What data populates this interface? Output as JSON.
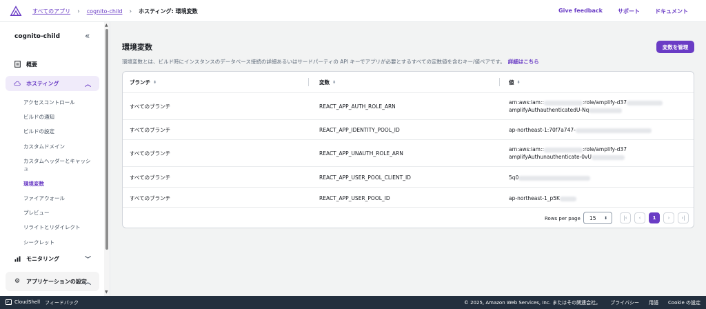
{
  "breadcrumb": {
    "items": [
      "すべてのアプリ",
      "cognito-child"
    ],
    "current": "ホスティング: 環境変数"
  },
  "top_links": [
    "Give feedback",
    "サポート",
    "ドキュメント"
  ],
  "sidebar": {
    "title": "cognito-child",
    "overview": "概要",
    "hosting": "ホスティング",
    "hosting_items": [
      "アクセスコントロール",
      "ビルドの通知",
      "ビルドの設定",
      "カスタムドメイン",
      "カスタムヘッダーとキャッシュ",
      "環境変数",
      "ファイアウォール",
      "プレビュー",
      "リライトとリダイレクト",
      "シークレット"
    ],
    "monitoring": "モニタリング",
    "app_settings": "アプリケーションの設定"
  },
  "main": {
    "title": "環境変数",
    "manage_button": "変数を管理",
    "description": "環境変数とは、ビルド時にインスタンスのデータベース接続の詳細あるいはサードパーティの API キーでアプリが必要とするすべての定数値を含むキー/値ペアです。",
    "description_link": "詳細はこちら"
  },
  "table": {
    "headers": [
      "ブランチ",
      "変数",
      "値"
    ],
    "rows": [
      {
        "branch": "すべてのブランチ",
        "variable": "REACT_APP_AUTH_ROLE_ARN",
        "value_line1": "arn:aws:iam::",
        "value_line1b": ":role/amplify-d37",
        "value_line2": "amplifyAuthauthenticatedU-Nq"
      },
      {
        "branch": "すべてのブランチ",
        "variable": "REACT_APP_IDENTITY_POOL_ID",
        "value_line1": "ap-northeast-1:70f7a747-"
      },
      {
        "branch": "すべてのブランチ",
        "variable": "REACT_APP_UNAUTH_ROLE_ARN",
        "value_line1": "arn:aws:iam::",
        "value_line1b": ":role/amplify-d37",
        "value_line2": "amplifyAuthunauthenticate-0vU"
      },
      {
        "branch": "すべてのブランチ",
        "variable": "REACT_APP_USER_POOL_CLIENT_ID",
        "value_line1": "5q0"
      },
      {
        "branch": "すべてのブランチ",
        "variable": "REACT_APP_USER_POOL_ID",
        "value_line1": "ap-northeast-1_p5K"
      }
    ]
  },
  "pagination": {
    "rows_per_page_label": "Rows per page",
    "rows_per_page": "15",
    "current_page": "1"
  },
  "footer": {
    "cloudshell": "CloudShell",
    "feedback": "フィードバック",
    "copyright": "© 2025, Amazon Web Services, Inc. またはその関連会社。",
    "privacy": "プライバシー",
    "terms": "用語",
    "cookie": "Cookie の設定"
  }
}
